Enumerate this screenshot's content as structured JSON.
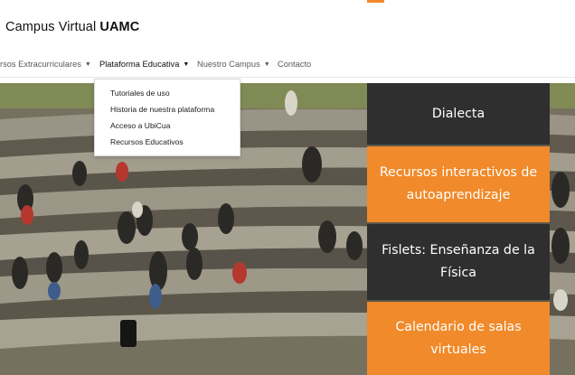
{
  "header": {
    "brand_light": "Campus Virtual ",
    "brand_bold": "UAMC"
  },
  "nav": {
    "items": [
      {
        "label": "rsos Extracurriculares"
      },
      {
        "label": "Plataforma Educativa"
      },
      {
        "label": "Nuestro Campus"
      },
      {
        "label": "Contacto"
      }
    ]
  },
  "dropdown": {
    "items": [
      {
        "label": "Tutoriales de uso"
      },
      {
        "label": "Historia de nuestra plataforma"
      },
      {
        "label": "Acceso a UbiCua"
      },
      {
        "label": "Recursos Educativos"
      }
    ]
  },
  "tiles": [
    {
      "label": "Dialecta"
    },
    {
      "label": "Recursos interactivos de autoaprendizaje"
    },
    {
      "label": "Fislets: Enseñanza de la Física"
    },
    {
      "label": "Calendario de salas virtuales"
    }
  ],
  "colors": {
    "accent": "#f08a2a",
    "tile_dark": "#2f2f2f",
    "text": "#111111"
  }
}
